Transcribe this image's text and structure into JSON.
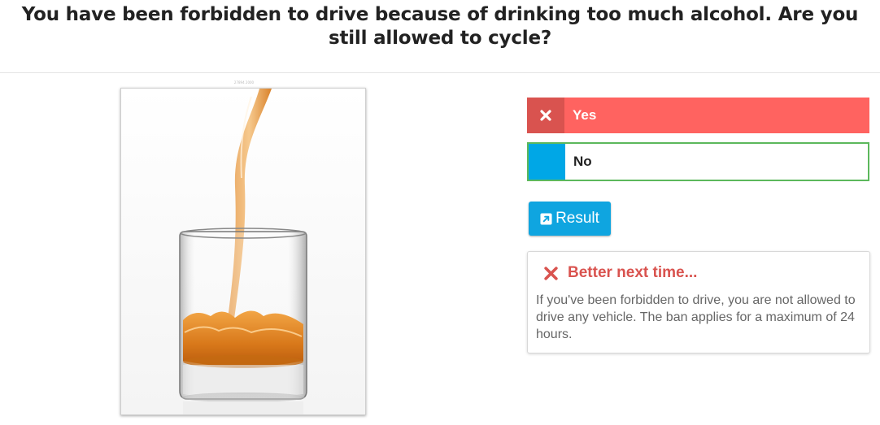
{
  "question": {
    "line1": "You have been forbidden to drive because of drinking too much alcohol. Are you",
    "line2": "still allowed to cycle?"
  },
  "image": {
    "credit": "27894 2000",
    "subject": "whiskey-pour-photo"
  },
  "answers": [
    {
      "label": "Yes",
      "state": "selected-incorrect",
      "mark_icon": "close-icon",
      "color": "#ff6360",
      "mark_color": "#d9534f"
    },
    {
      "label": "No",
      "state": "correct",
      "mark_icon": "",
      "color": "#ffffff",
      "mark_color": "#00a7e6",
      "border_color": "#5cb85c"
    }
  ],
  "result_button": {
    "label": "Result",
    "icon": "external-link-icon",
    "color": "#0fa5e0"
  },
  "feedback": {
    "icon": "close-icon",
    "title": "Better next time...",
    "body": "If you've been forbidden to drive, you are not allowed to drive any vehicle. The ban applies for a maximum of 24 hours.",
    "title_color": "#d9534f"
  }
}
